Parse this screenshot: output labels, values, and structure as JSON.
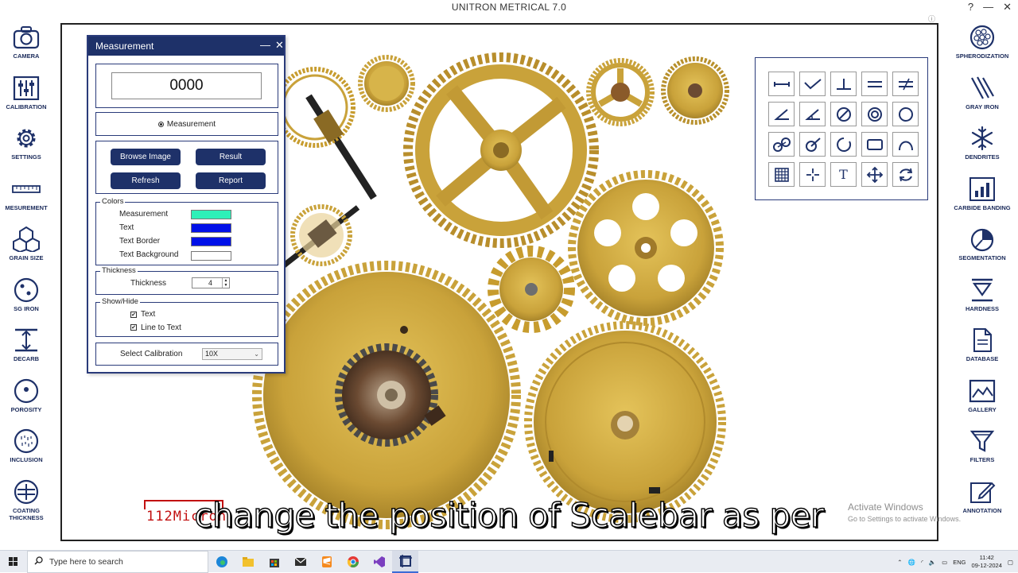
{
  "app": {
    "title": "UNITRON METRICAL 7.0",
    "help": "?",
    "minimize": "—",
    "close": "✕"
  },
  "left_sidebar": [
    {
      "label": "CAMERA",
      "icon": "camera-icon"
    },
    {
      "label": "CALIBRATION",
      "icon": "calibration-sliders-icon"
    },
    {
      "label": "SETTINGS",
      "icon": "gear-icon"
    },
    {
      "label": "MESUREMENT",
      "icon": "ruler-icon"
    },
    {
      "label": "GRAIN SIZE",
      "icon": "grain-size-icon"
    },
    {
      "label": "SG IRON",
      "icon": "sg-iron-icon"
    },
    {
      "label": "DECARB",
      "icon": "decarb-icon"
    },
    {
      "label": "POROSITY",
      "icon": "porosity-icon"
    },
    {
      "label": "INCLUSION",
      "icon": "inclusion-icon"
    },
    {
      "label": "COATING THICKNESS",
      "icon": "coating-thickness-icon"
    }
  ],
  "right_sidebar": [
    {
      "label": "SPHERODIZATION",
      "icon": "spherodization-icon"
    },
    {
      "label": "GRAY IRON",
      "icon": "gray-iron-icon"
    },
    {
      "label": "DENDRITES",
      "icon": "snowflake-icon"
    },
    {
      "label": "CARBIDE BANDING",
      "icon": "bar-chart-icon"
    },
    {
      "label": "SEGMENTATION",
      "icon": "pie-chart-icon"
    },
    {
      "label": "HARDNESS",
      "icon": "hardness-icon"
    },
    {
      "label": "DATABASE",
      "icon": "document-icon"
    },
    {
      "label": "GALLERY",
      "icon": "gallery-icon"
    },
    {
      "label": "FILTERS",
      "icon": "funnel-icon"
    },
    {
      "label": "ANNOTATION",
      "icon": "pencil-icon"
    }
  ],
  "measurement_panel": {
    "title": "Measurement",
    "readout": "0000",
    "mode_label": "Measurement",
    "buttons": {
      "browse": "Browse Image",
      "result": "Result",
      "refresh": "Refresh",
      "report": "Report"
    },
    "colors": {
      "group_label": "Colors",
      "rows": [
        {
          "label": "Measurement",
          "color": "#2ef0b8"
        },
        {
          "label": "Text",
          "color": "#0010e8"
        },
        {
          "label": "Text Border",
          "color": "#0010e8"
        },
        {
          "label": "Text Background",
          "color": "#ffffff"
        }
      ]
    },
    "thickness": {
      "group_label": "Thickness",
      "label": "Thickness",
      "value": "4"
    },
    "show_hide": {
      "group_label": "Show/Hide",
      "text_label": "Text",
      "line_label": "Line to Text"
    },
    "calibration": {
      "label": "Select Calibration",
      "value": "10X"
    }
  },
  "toolbox": {
    "tools": [
      "line-tool-icon",
      "polyline-tool-icon",
      "perpendicular-tool-icon",
      "parallel-lines-tool-icon",
      "not-parallel-tool-icon",
      "angle-tool-icon",
      "angle-arc-tool-icon",
      "circle-diameter-tool-icon",
      "concentric-circles-tool-icon",
      "circle-tool-icon",
      "circle-to-circle-tool-icon",
      "circle-radius-tool-icon",
      "arc-tool-icon",
      "rectangle-tool-icon",
      "curve-tool-icon",
      "grid-tool-icon",
      "crosshair-tool-icon",
      "text-tool-icon",
      "move-tool-icon",
      "refresh-tool-icon"
    ],
    "text_tool_glyph": "T"
  },
  "scalebar": {
    "text": "112Micron"
  },
  "caption": "change the position of Scalebar as per",
  "watermark": {
    "line1": "Activate Windows",
    "line2": "Go to Settings to activate Windows."
  },
  "taskbar": {
    "search_placeholder": "Type here to search",
    "lang": "ENG",
    "time": "11:42",
    "date": "09-12-2024"
  },
  "colors": {
    "accent": "#1e3169",
    "scalebar": "#c21010",
    "brass": "#c9a43c"
  }
}
